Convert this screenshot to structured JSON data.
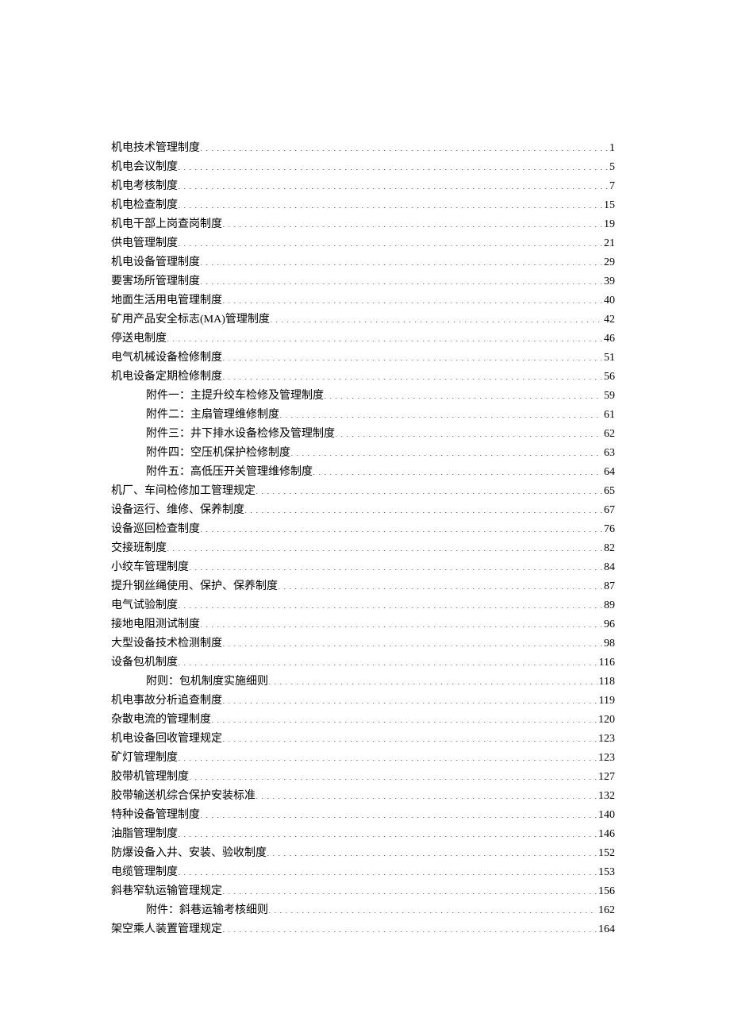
{
  "toc": [
    {
      "title": "机电技术管理制度",
      "page": "1",
      "indent": 0
    },
    {
      "title": "机电会议制度",
      "page": "5",
      "indent": 0
    },
    {
      "title": "机电考核制度",
      "page": "7",
      "indent": 0
    },
    {
      "title": "机电检查制度",
      "page": "15",
      "indent": 0
    },
    {
      "title": "机电干部上岗查岗制度",
      "page": "19",
      "indent": 0
    },
    {
      "title": "供电管理制度",
      "page": "21",
      "indent": 0
    },
    {
      "title": "机电设备管理制度",
      "page": "29",
      "indent": 0
    },
    {
      "title": "要害场所管理制度",
      "page": "39",
      "indent": 0
    },
    {
      "title": "地面生活用电管理制度",
      "page": "40",
      "indent": 0
    },
    {
      "title": "矿用产品安全标志(MA)管理制度",
      "page": "42",
      "indent": 0
    },
    {
      "title": "停送电制度",
      "page": "46",
      "indent": 0
    },
    {
      "title": "电气机械设备检修制度",
      "page": "51",
      "indent": 0
    },
    {
      "title": "机电设备定期检修制度",
      "page": "56",
      "indent": 0
    },
    {
      "title": "附件一：主提升绞车检修及管理制度",
      "page": "59",
      "indent": 1
    },
    {
      "title": "附件二：主扇管理维修制度",
      "page": "61",
      "indent": 1
    },
    {
      "title": "附件三：井下排水设备检修及管理制度",
      "page": "62",
      "indent": 1
    },
    {
      "title": "附件四：空压机保护检修制度",
      "page": "63",
      "indent": 1
    },
    {
      "title": "附件五：高低压开关管理维修制度",
      "page": "64",
      "indent": 1
    },
    {
      "title": "机厂、车间检修加工管理规定",
      "page": "65",
      "indent": 0
    },
    {
      "title": "设备运行、维修、保养制度",
      "page": "67",
      "indent": 0
    },
    {
      "title": "设备巡回检查制度",
      "page": "76",
      "indent": 0
    },
    {
      "title": "交接班制度",
      "page": "82",
      "indent": 0
    },
    {
      "title": "小绞车管理制度",
      "page": "84",
      "indent": 0
    },
    {
      "title": "提升钢丝绳使用、保护、保养制度",
      "page": "87",
      "indent": 0
    },
    {
      "title": "电气试验制度",
      "page": "89",
      "indent": 0
    },
    {
      "title": "接地电阻测试制度",
      "page": "96",
      "indent": 0
    },
    {
      "title": "大型设备技术检测制度",
      "page": "98",
      "indent": 0
    },
    {
      "title": "设备包机制度",
      "page": "116",
      "indent": 0
    },
    {
      "title": "附则：包机制度实施细则",
      "page": "118",
      "indent": 1
    },
    {
      "title": "机电事故分析追查制度",
      "page": "119",
      "indent": 0
    },
    {
      "title": "杂散电流的管理制度",
      "page": "120",
      "indent": 0
    },
    {
      "title": "机电设备回收管理规定",
      "page": "123",
      "indent": 0
    },
    {
      "title": "矿灯管理制度",
      "page": "123",
      "indent": 0
    },
    {
      "title": "胶带机管理制度",
      "page": "127",
      "indent": 0
    },
    {
      "title": "胶带输送机综合保护安装标准",
      "page": "132",
      "indent": 0
    },
    {
      "title": "特种设备管理制度",
      "page": "140",
      "indent": 0
    },
    {
      "title": "油脂管理制度",
      "page": "146",
      "indent": 0
    },
    {
      "title": "防爆设备入井、安装、验收制度",
      "page": "152",
      "indent": 0
    },
    {
      "title": "电缆管理制度",
      "page": "153",
      "indent": 0
    },
    {
      "title": "斜巷窄轨运输管理规定",
      "page": "156",
      "indent": 0
    },
    {
      "title": "附件：斜巷运输考核细则",
      "page": "162",
      "indent": 1
    },
    {
      "title": "架空乘人装置管理规定",
      "page": "164",
      "indent": 0
    }
  ]
}
